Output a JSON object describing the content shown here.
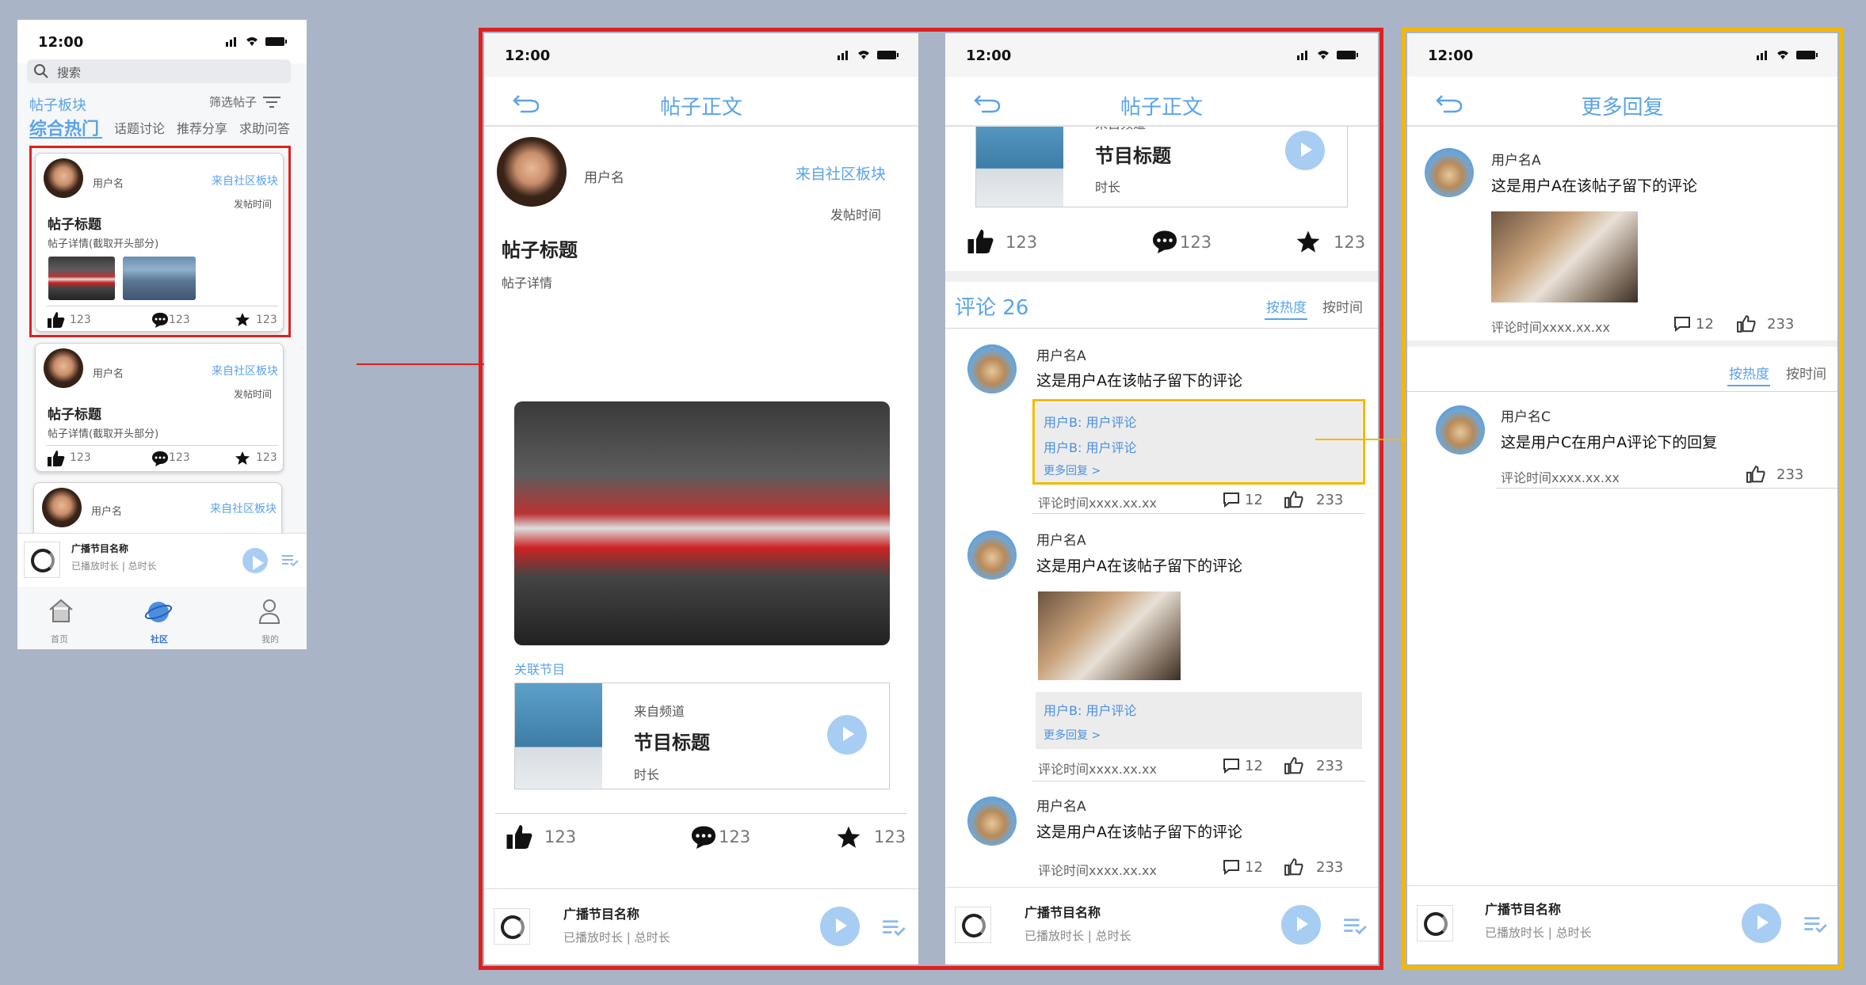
{
  "status_time": "12:00",
  "s1": {
    "search_placeholder": "搜索",
    "section_label": "帖子板块",
    "filter_label": "筛选帖子",
    "tabs": [
      "综合热门",
      "话题讨论",
      "推荐分享",
      "求助问答"
    ],
    "posts": [
      {
        "username": "用户名",
        "source": "来自社区板块",
        "time": "发帖时间",
        "title": "帖子标题",
        "excerpt": "帖子详情(截取开头部分)",
        "likes": "123",
        "comments": "123",
        "favs": "123"
      },
      {
        "username": "用户名",
        "source": "来自社区板块",
        "time": "发帖时间",
        "title": "帖子标题",
        "excerpt": "帖子详情(截取开头部分)",
        "likes": "123",
        "comments": "123",
        "favs": "123"
      },
      {
        "username": "用户名",
        "source": "来自社区板块"
      }
    ],
    "player": {
      "title": "广播节目名称",
      "sub": "已播放时长 | 总时长"
    },
    "tabbar": [
      "首页",
      "社区",
      "我的"
    ]
  },
  "s2": {
    "nav_title": "帖子正文",
    "username": "用户名",
    "source": "来自社区板块",
    "time": "发帖时间",
    "title": "帖子标题",
    "detail": "帖子详情",
    "related_label": "关联节目",
    "program": {
      "channel": "来自频道",
      "title": "节目标题",
      "duration": "时长"
    },
    "likes": "123",
    "comments": "123",
    "favs": "123",
    "player": {
      "title": "广播节目名称",
      "sub": "已播放时长 | 总时长"
    }
  },
  "s3": {
    "nav_title": "帖子正文",
    "program": {
      "channel": "来自频道",
      "title": "节目标题",
      "duration": "时长"
    },
    "likes": "123",
    "comments": "123",
    "favs": "123",
    "comment_header": "评论 26",
    "sort_hot": "按热度",
    "sort_time": "按时间",
    "comments_list": [
      {
        "name": "用户名A",
        "text": "这是用户A在该帖子留下的评论",
        "replies": [
          "用户B: 用户评论",
          "用户B: 用户评论"
        ],
        "more": "更多回复 >",
        "time": "评论时间xxxx.xx.xx",
        "reply_count": "12",
        "likes": "233"
      },
      {
        "name": "用户名A",
        "text": "这是用户A在该帖子留下的评论",
        "replies": [
          "用户B: 用户评论"
        ],
        "more": "更多回复 >",
        "time": "评论时间xxxx.xx.xx",
        "reply_count": "12",
        "likes": "233"
      },
      {
        "name": "用户名A",
        "text": "这是用户A在该帖子留下的评论",
        "time": "评论时间xxxx.xx.xx",
        "reply_count": "12",
        "likes": "233"
      }
    ],
    "player": {
      "title": "广播节目名称",
      "sub": "已播放时长 | 总时长"
    }
  },
  "s4": {
    "nav_title": "更多回复",
    "main": {
      "name": "用户名A",
      "text": "这是用户A在该帖子留下的评论",
      "time": "评论时间xxxx.xx.xx",
      "reply_count": "12",
      "likes": "233"
    },
    "sort_hot": "按热度",
    "sort_time": "按时间",
    "reply": {
      "name": "用户名C",
      "text": "这是用户C在用户A评论下的回复",
      "time": "评论时间xxxx.xx.xx",
      "likes": "233"
    },
    "player": {
      "title": "广播节目名称",
      "sub": "已播放时长 | 总时长"
    }
  },
  "colors": {
    "accent": "#5aa3ea",
    "highlight_red": "#e0201f",
    "highlight_yellow": "#f5b800",
    "background": "#a9b4c6"
  }
}
